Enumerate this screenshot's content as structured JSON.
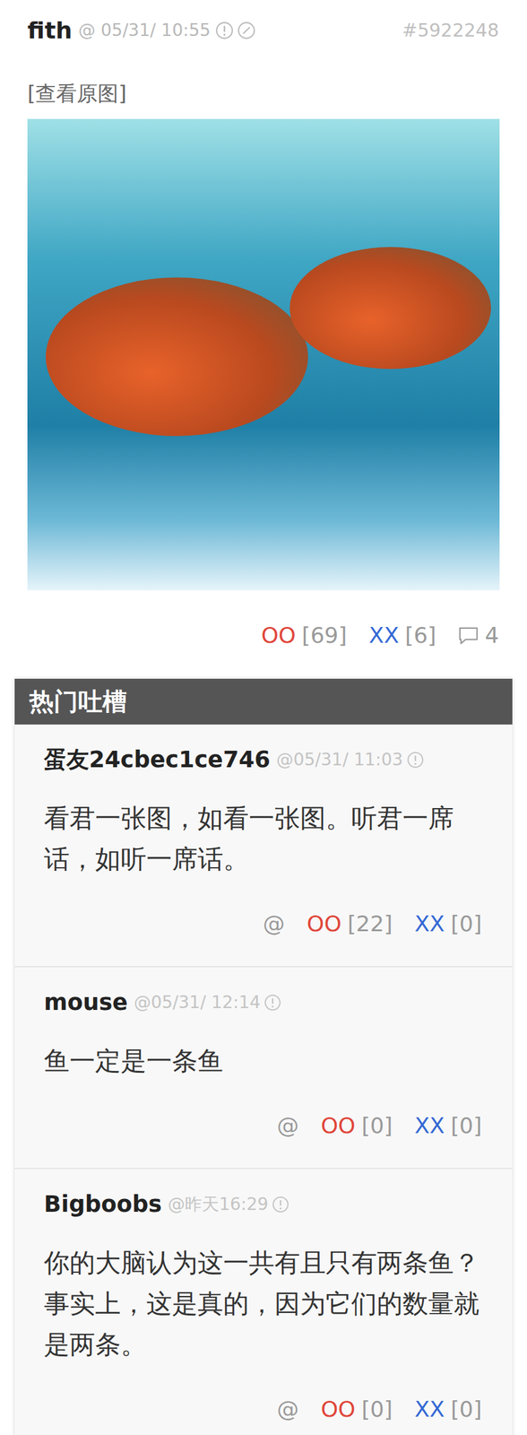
{
  "post": {
    "author": "fith",
    "time": "@ 05/31/ 10:55",
    "id": "#5922248",
    "view_original": "[查看原图]",
    "oo_label": "OO",
    "oo_count": "[69]",
    "xx_label": "XX",
    "xx_count": "[6]",
    "comment_count": "4"
  },
  "hot_comments": {
    "title": "热门吐槽",
    "items": [
      {
        "author": "蛋友24cbec1ce746",
        "time": "@05/31/ 11:03",
        "text": "看君一张图，如看一张图。听君一席话，如听一席话。",
        "at": "@",
        "oo_label": "OO",
        "oo_count": "[22]",
        "xx_label": "XX",
        "xx_count": "[0]"
      },
      {
        "author": "mouse",
        "time": "@05/31/ 12:14",
        "text": "鱼一定是一条鱼",
        "at": "@",
        "oo_label": "OO",
        "oo_count": "[0]",
        "xx_label": "XX",
        "xx_count": "[0]"
      },
      {
        "author": "Bigboobs",
        "time": "@昨天16:29",
        "text": "你的大脑认为这一共有且只有两条鱼？事实上，这是真的，因为它们的数量就是两条。",
        "at": "@",
        "oo_label": "OO",
        "oo_count": "[0]",
        "xx_label": "XX",
        "xx_count": "[0]"
      }
    ]
  }
}
